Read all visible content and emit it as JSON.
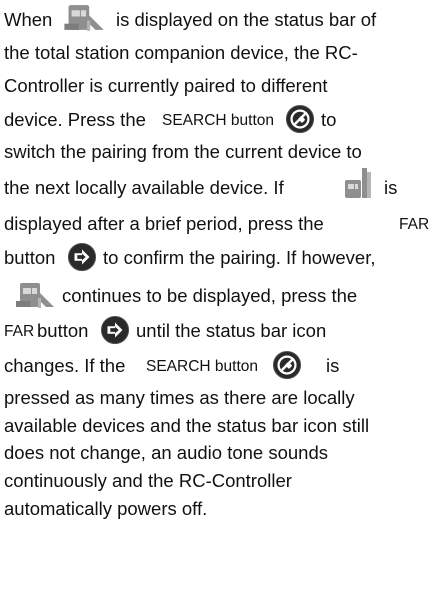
{
  "paragraph": {
    "l1a": "When",
    "l1b": "is displayed on the status bar of",
    "l2": "the total station companion device, the RC-",
    "l3": "Controller is currently paired to different",
    "l4a": "device. Press the",
    "l4b": "SEARCH button",
    "l4c": "to",
    "l5": "switch the pairing from the current device to",
    "l6a": "the next locally available device. If",
    "l6b": "is",
    "l7a": "displayed after a brief period, press the",
    "l7b": "FAR",
    "l8a": "button",
    "l8b": "to confirm the pairing. If however,",
    "l9": "continues to be displayed, press the",
    "l10a": "FAR",
    "l10b": "button",
    "l10c": "until the status bar icon",
    "l11a": "changes. If the",
    "l11b": "SEARCH button",
    "l11c": "is",
    "l12": "pressed as many times as there are locally",
    "l13": "available devices and the status bar icon still",
    "l14": "does not change, an audio tone sounds",
    "l15": "continuously and the RC-Controller",
    "l16": "automatically powers off."
  },
  "icons": {
    "unpaired_status": "unpaired-status-icon",
    "paired_status": "paired-status-icon",
    "search_button": "search-button-icon",
    "far_button": "far-button-icon"
  },
  "colors": {
    "text": "#111111",
    "status_icon_gray": "#8c8c8c",
    "button_fill": "#2a2a2a"
  }
}
